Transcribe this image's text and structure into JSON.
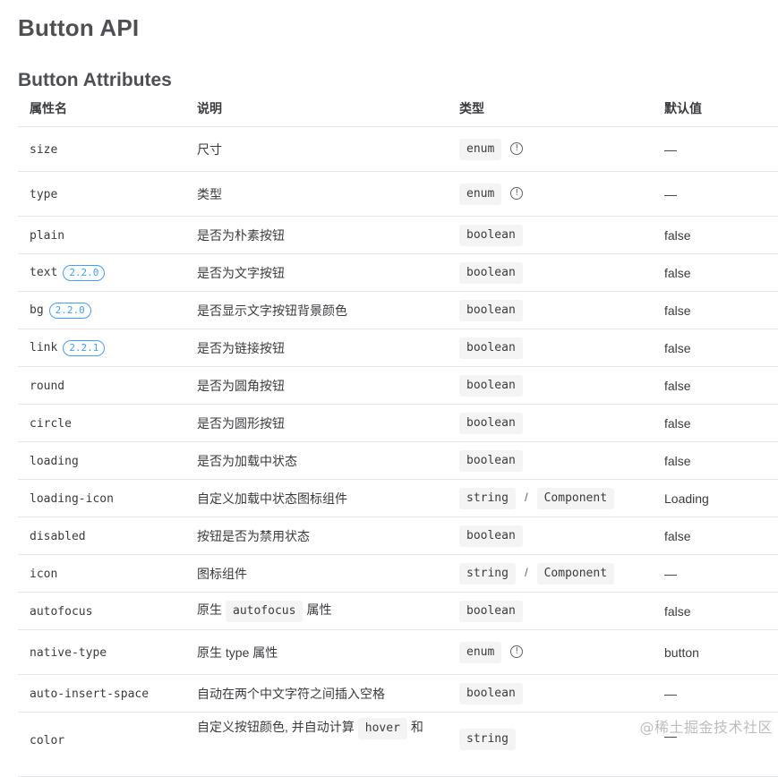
{
  "title": "Button API",
  "subtitle": "Button Attributes",
  "headers": {
    "name": "属性名",
    "desc": "说明",
    "type": "类型",
    "default": "默认值"
  },
  "rows": [
    {
      "name": "size",
      "desc": "尺寸",
      "type1": "enum",
      "default": "—"
    },
    {
      "name": "type",
      "desc": "类型",
      "type1": "enum",
      "default": "—"
    },
    {
      "name": "plain",
      "desc": "是否为朴素按钮",
      "type1": "boolean",
      "default": "false"
    },
    {
      "name": "text",
      "version": "2.2.0",
      "desc": "是否为文字按钮",
      "type1": "boolean",
      "default": "false"
    },
    {
      "name": "bg",
      "version": "2.2.0",
      "desc": "是否显示文字按钮背景颜色",
      "type1": "boolean",
      "default": "false"
    },
    {
      "name": "link",
      "version": "2.2.1",
      "desc": "是否为链接按钮",
      "type1": "boolean",
      "default": "false"
    },
    {
      "name": "round",
      "desc": "是否为圆角按钮",
      "type1": "boolean",
      "default": "false"
    },
    {
      "name": "circle",
      "desc": "是否为圆形按钮",
      "type1": "boolean",
      "default": "false"
    },
    {
      "name": "loading",
      "desc": "是否为加载中状态",
      "type1": "boolean",
      "default": "false"
    },
    {
      "name": "loading-icon",
      "desc": "自定义加载中状态图标组件",
      "type1": "string",
      "type_sep": "/",
      "type2": "Component",
      "default": "Loading"
    },
    {
      "name": "disabled",
      "desc": "按钮是否为禁用状态",
      "type1": "boolean",
      "default": "false"
    },
    {
      "name": "icon",
      "desc": "图标组件",
      "type1": "string",
      "type_sep": "/",
      "type2": "Component",
      "default": "—"
    },
    {
      "name": "autofocus",
      "desc_pre": "原生",
      "desc_code": "autofocus",
      "desc_post": "属性",
      "type1": "boolean",
      "default": "false"
    },
    {
      "name": "native-type",
      "desc": "原生 type 属性",
      "type1": "enum",
      "default": "button"
    },
    {
      "name": "auto-insert-space",
      "desc": "自动在两个中文字符之间插入空格",
      "type1": "boolean",
      "default": "—"
    },
    {
      "name": "color",
      "desc_pre": "自定义按钮颜色, 并自动计算",
      "desc_code": "hover",
      "desc_post": "和",
      "type1": "string",
      "default": "—"
    }
  ],
  "watermark": "@稀土掘金技术社区",
  "colors": {
    "version_badge": "#409eff",
    "code_bg": "#f4f4f5",
    "border": "#e4e6ea"
  },
  "icons": {
    "info": "info-circle-icon"
  }
}
